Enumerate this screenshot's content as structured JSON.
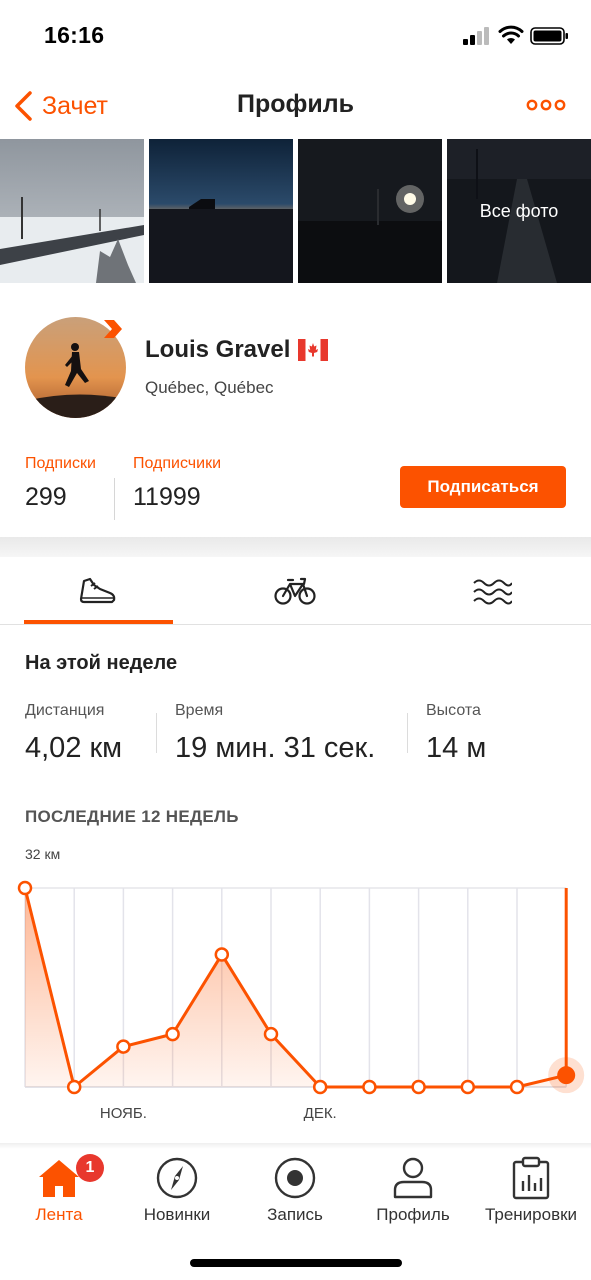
{
  "status_bar": {
    "time": "16:16"
  },
  "nav": {
    "back_label": "Зачет",
    "title": "Профиль"
  },
  "photos": {
    "all_photos_label": "Все фото"
  },
  "profile": {
    "name": "Louis Gravel",
    "location": "Québec, Québec",
    "following_label": "Подписки",
    "following_count": "299",
    "followers_label": "Подписчики",
    "followers_count": "11999",
    "subscribe_label": "Подписаться"
  },
  "sport_tabs": [
    {
      "icon": "running-shoe-icon",
      "active": true
    },
    {
      "icon": "bicycle-icon",
      "active": false
    },
    {
      "icon": "swimming-waves-icon",
      "active": false
    }
  ],
  "this_week": {
    "title": "На этой неделе",
    "stats": [
      {
        "label": "Дистанция",
        "value": "4,02 км"
      },
      {
        "label": "Время",
        "value": "19 мин. 31 сек."
      },
      {
        "label": "Высота",
        "value": "14 м"
      }
    ]
  },
  "chart_data": {
    "type": "area",
    "title": "ПОСЛЕДНИЕ 12 НЕДЕЛЬ",
    "ymax_label": "32 км",
    "ylim": [
      0,
      32
    ],
    "x": [
      1,
      2,
      3,
      4,
      5,
      6,
      7,
      8,
      9,
      10,
      11,
      12
    ],
    "month_labels": [
      {
        "label": "НОЯБ.",
        "at_week": 3
      },
      {
        "label": "ДЕК.",
        "at_week": 7
      }
    ],
    "series": [
      {
        "values": [
          32,
          0,
          6.5,
          8.5,
          21.3,
          8.5,
          0,
          0,
          0,
          0,
          0,
          1.9
        ]
      }
    ],
    "current_week": 12,
    "color": "#fc5200",
    "grid": true
  },
  "tabbar": {
    "items": [
      {
        "label": "Лента",
        "icon": "home-icon",
        "active": true,
        "badge": "1"
      },
      {
        "label": "Новинки",
        "icon": "compass-icon",
        "active": false
      },
      {
        "label": "Запись",
        "icon": "record-icon",
        "active": false
      },
      {
        "label": "Профиль",
        "icon": "profile-icon",
        "active": false
      },
      {
        "label": "Тренировки",
        "icon": "clipboard-chart-icon",
        "active": false
      }
    ]
  },
  "colors": {
    "accent": "#fc5200",
    "badge": "#e8382d"
  }
}
